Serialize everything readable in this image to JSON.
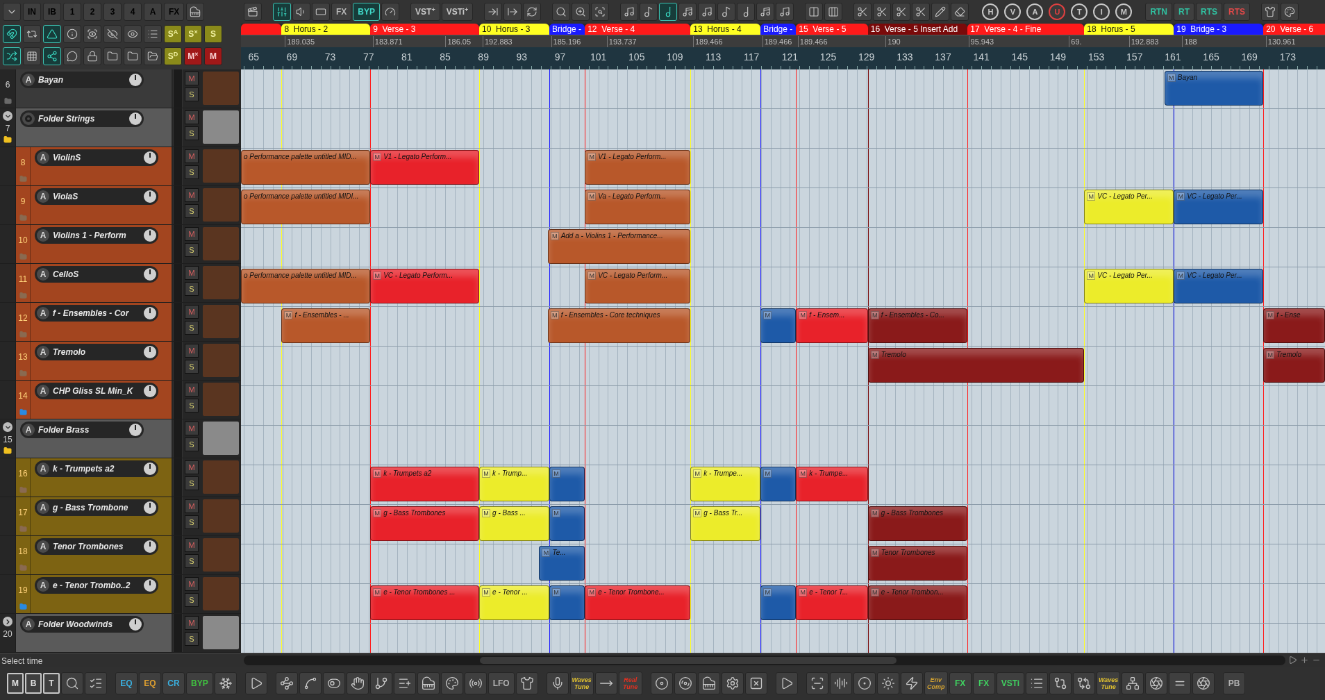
{
  "header_toolbar": [
    [
      {
        "kind": "icon",
        "on": false
      },
      {
        "kind": "text",
        "label": "IN",
        "on": false
      },
      {
        "kind": "text",
        "label": "IB",
        "on": false
      },
      {
        "kind": "text",
        "label": "1",
        "on": false
      },
      {
        "kind": "text",
        "label": "2",
        "on": false
      },
      {
        "kind": "text",
        "label": "3",
        "on": false
      },
      {
        "kind": "text",
        "label": "4",
        "on": false
      },
      {
        "kind": "text",
        "label": "A",
        "on": false
      },
      {
        "kind": "text",
        "label": "FX",
        "on": false
      },
      {
        "kind": "icon",
        "on": false
      }
    ],
    [
      {
        "kind": "icon",
        "on": true
      },
      {
        "kind": "icon",
        "on": false
      },
      {
        "kind": "icon",
        "on": true
      },
      {
        "kind": "icon",
        "on": false
      },
      {
        "kind": "icon",
        "on": false
      },
      {
        "kind": "icon",
        "on": false
      },
      {
        "kind": "icon",
        "on": false
      },
      {
        "kind": "icon",
        "on": false
      },
      {
        "kind": "solo",
        "label": "S$^{A}$",
        "on": false
      },
      {
        "kind": "solo",
        "label": "S$^{×}$",
        "on": false
      },
      {
        "kind": "solo",
        "label": "S",
        "on": false
      }
    ],
    [
      {
        "kind": "icon",
        "on": true
      },
      {
        "kind": "icon",
        "on": false
      },
      {
        "kind": "icon",
        "on": true
      },
      {
        "kind": "icon",
        "on": false
      },
      {
        "kind": "icon",
        "on": false
      },
      {
        "kind": "icon",
        "on": false
      },
      {
        "kind": "icon",
        "on": false
      },
      {
        "kind": "icon",
        "on": false
      },
      {
        "kind": "solo",
        "label": "S$^{D}$",
        "on": false
      },
      {
        "kind": "mute",
        "label": "M$^{×}$",
        "on": false
      },
      {
        "kind": "mute",
        "label": "M",
        "on": false
      }
    ]
  ],
  "main_toolbar": [
    [
      {
        "kind": "icon",
        "on": false
      }
    ],
    [
      {
        "kind": "icon",
        "on": true
      },
      {
        "kind": "icon",
        "on": false
      },
      {
        "kind": "icon",
        "on": false
      },
      {
        "kind": "text",
        "label": "FX",
        "color": "#b8b8b8",
        "on": false
      },
      {
        "kind": "text",
        "label": "BYP",
        "color": "#40d8c8",
        "on": true
      },
      {
        "kind": "icon",
        "on": false
      }
    ],
    [
      {
        "kind": "text",
        "label": "VST$^{+}$",
        "color": "#c8c8c8",
        "on": false
      },
      {
        "kind": "text",
        "label": "VSTi$^{+}$",
        "color": "#c8c8c8",
        "on": false
      }
    ],
    [
      {
        "kind": "icon",
        "on": false
      },
      {
        "kind": "icon",
        "on": false
      },
      {
        "kind": "icon",
        "on": false
      }
    ],
    [
      {
        "kind": "icon",
        "on": false
      },
      {
        "kind": "icon",
        "on": false
      },
      {
        "kind": "icon",
        "on": false
      }
    ],
    [
      {
        "kind": "icon",
        "on": false
      },
      {
        "kind": "icon",
        "on": false
      },
      {
        "kind": "icon",
        "on": true
      },
      {
        "kind": "icon",
        "on": false
      },
      {
        "kind": "icon",
        "on": false
      },
      {
        "kind": "icon",
        "on": false
      },
      {
        "kind": "icon",
        "on": false
      },
      {
        "kind": "icon",
        "on": false
      },
      {
        "kind": "icon",
        "on": false
      }
    ],
    [
      {
        "kind": "icon",
        "on": false
      },
      {
        "kind": "icon",
        "on": false
      }
    ],
    [
      {
        "kind": "icon",
        "on": false
      },
      {
        "kind": "icon",
        "on": false
      },
      {
        "kind": "icon",
        "on": false
      },
      {
        "kind": "icon",
        "on": false
      },
      {
        "kind": "icon",
        "on": false
      },
      {
        "kind": "icon",
        "on": false
      }
    ],
    [
      {
        "kind": "zoom",
        "label": "H",
        "color": "#c8c8c8",
        "on": false
      },
      {
        "kind": "zoom",
        "label": "V",
        "color": "#c8c8c8",
        "on": false
      },
      {
        "kind": "zoom",
        "label": "A",
        "color": "#c8c8c8",
        "on": false
      },
      {
        "kind": "zoom",
        "label": "U",
        "color": "#e04040",
        "on": false
      },
      {
        "kind": "zoom",
        "label": "T",
        "color": "#c8c8c8",
        "on": false
      },
      {
        "kind": "zoom",
        "label": "I",
        "color": "#c8c8c8",
        "on": false
      },
      {
        "kind": "zoom",
        "label": "M",
        "color": "#c8c8c8",
        "on": false
      }
    ],
    [
      {
        "kind": "text",
        "label": "RTN",
        "color": "#30c0a0",
        "on": false
      },
      {
        "kind": "text",
        "label": "RT",
        "color": "#30c0a0",
        "on": false
      },
      {
        "kind": "text",
        "label": "RTS",
        "color": "#30c0a0",
        "on": false
      },
      {
        "kind": "text",
        "label": "RTS",
        "color": "#e04848",
        "on": false
      }
    ],
    [
      {
        "kind": "icon",
        "on": false
      },
      {
        "kind": "icon",
        "on": false
      }
    ]
  ],
  "markers": [
    {
      "color": "#ff1a1a"
    },
    {
      "label": "8  Horus - 2",
      "color": "#ffff22"
    },
    {
      "label": "9  Verse - 3",
      "color": "#ff1a1a"
    },
    {
      "label": "10  Horus - 3",
      "color": "#ffff22"
    },
    {
      "label": "Bridge -",
      "color": "#1a1aff"
    },
    {
      "label": "12  Verse - 4",
      "color": "#ff1a1a"
    },
    {
      "label": "13  Horus - 4",
      "color": "#ffff22"
    },
    {
      "label": "Bridge -",
      "color": "#1a1aff"
    },
    {
      "label": "15  Verse - 5",
      "color": "#ff1a1a"
    },
    {
      "label": "16  Verse - 5 Insert Add",
      "color": "#7a0a0a"
    },
    {
      "label": "17  Verse - 4 - Fine",
      "color": "#ff1a1a"
    },
    {
      "label": "18  Horus - 5",
      "color": "#ffff22"
    },
    {
      "label": "19  Bridge - 3",
      "color": "#1a1aff"
    },
    {
      "label": "20  Verse - 6",
      "color": "#ff1a1a"
    }
  ],
  "tempo_row": [
    "189.035",
    "183.871",
    "186.05",
    "192.883",
    "185.196",
    "193.737",
    "189.466",
    "189.466",
    "189.466",
    "190",
    "95.943",
    "69.",
    "192.883",
    "188",
    "130.961"
  ],
  "ruler": [
    "65",
    "69",
    "73",
    "77",
    "81",
    "85",
    "89",
    "93",
    "97",
    "101",
    "105",
    "109",
    "113",
    "117",
    "121",
    "125",
    "129",
    "133",
    "137",
    "141",
    "145",
    "149",
    "153",
    "157",
    "161",
    "165",
    "169",
    "173"
  ],
  "tracks": [
    {
      "kind": "track",
      "number": "6",
      "name": "Bayan",
      "color": "#3a3a3a",
      "automation": "A",
      "mute": "M",
      "solo": "S",
      "clips": [
        {
          "label": "Bayan",
          "color": "#1e5aa8",
          "mute": "M"
        }
      ]
    },
    {
      "kind": "folder",
      "number": "7",
      "name": "Folder Strings",
      "color": "#5a5a5a",
      "expanded": true,
      "mute": "M",
      "solo": "S",
      "children": [
        {
          "kind": "track",
          "number": "8",
          "name": "ViolinS",
          "color": "#a3451f",
          "automation": "A",
          "mute": "M",
          "solo": "S",
          "clips": [
            {
              "label": "o Performance palette untitled MID...",
              "color": "#b8582a"
            },
            {
              "label": "V1 - Legato Perform...",
              "color": "#e8222a",
              "mute": "M"
            },
            {
              "label": "V1 - Legato Perform...",
              "color": "#b8582a",
              "mute": "M"
            }
          ]
        },
        {
          "kind": "track",
          "number": "9",
          "name": "ViolaS",
          "color": "#a3451f",
          "automation": "A",
          "mute": "M",
          "solo": "S",
          "clips": [
            {
              "label": "o Performance palette untitled MIDI...",
              "color": "#b8582a"
            },
            {
              "label": "Va - Legato Perform...",
              "color": "#b8582a",
              "mute": "M"
            },
            {
              "label": "VC - Legato Per...",
              "color": "#ecec2a",
              "mute": "M"
            },
            {
              "label": "VC - Legato Per...",
              "color": "#1e5aa8",
              "mute": "M"
            }
          ]
        },
        {
          "kind": "track",
          "number": "10",
          "name": "Violins 1 - Perform",
          "color": "#a3451f",
          "automation": "A",
          "mute": "M",
          "solo": "S",
          "clips": [
            {
              "label": "Add a - Violins 1 - Performance...",
              "color": "#b8582a",
              "mute": "M"
            }
          ]
        },
        {
          "kind": "track",
          "number": "11",
          "name": "CelloS",
          "color": "#a3451f",
          "automation": "A",
          "mute": "M",
          "solo": "S",
          "clips": [
            {
              "label": "o Performance palette untitled MID...",
              "color": "#b8582a"
            },
            {
              "label": "VC - Legato Perform...",
              "color": "#e8222a",
              "mute": "M"
            },
            {
              "label": "VC - Legato Perform...",
              "color": "#b8582a",
              "mute": "M"
            },
            {
              "label": "VC - Legato Per...",
              "color": "#ecec2a",
              "mute": "M"
            },
            {
              "label": "VC - Legato Per...",
              "color": "#1e5aa8",
              "mute": "M"
            }
          ]
        },
        {
          "kind": "track",
          "number": "12",
          "name": "f - Ensembles - Cor",
          "color": "#a3451f",
          "automation": "A",
          "mute": "M",
          "solo": "S",
          "clips": [
            {
              "label": "f - Ensembles - ...",
              "color": "#b8582a",
              "mute": "M"
            },
            {
              "label": "f - Ensembles - Core techniques",
              "color": "#b8582a",
              "mute": "M"
            },
            {
              "color": "#1e5aa8",
              "mute": "M"
            },
            {
              "label": "f - Ensem...",
              "color": "#e8222a",
              "mute": "M"
            },
            {
              "label": "f - Ensembles - Co...",
              "color": "#8a1a1a",
              "mute": "M"
            },
            {
              "label": "f - Ense",
              "color": "#8a1a1a",
              "mute": "M"
            }
          ]
        },
        {
          "kind": "track",
          "number": "13",
          "name": "Tremolo",
          "color": "#a3451f",
          "automation": "A",
          "mute": "M",
          "solo": "S",
          "clips": [
            {
              "label": "Tremolo",
              "color": "#8a1a1a",
              "mute": "M"
            },
            {
              "label": "Tremolo",
              "color": "#8a1a1a",
              "mute": "M"
            }
          ]
        },
        {
          "kind": "track",
          "number": "14",
          "name": "CHP Gliss SL Min_K",
          "color": "#a3451f",
          "automation": "A",
          "mute": "M",
          "solo": "S"
        }
      ]
    },
    {
      "kind": "folder",
      "number": "15",
      "name": "Folder Brass",
      "color": "#5a5a5a",
      "expanded": true,
      "automation": "A",
      "mute": "M",
      "solo": "S",
      "children": [
        {
          "kind": "track",
          "number": "16",
          "name": "k - Trumpets a2",
          "color": "#7d6312",
          "automation": "A",
          "mute": "M",
          "solo": "S",
          "clips": [
            {
              "label": "k - Trumpets a2",
              "color": "#e8222a",
              "mute": "M"
            },
            {
              "label": "k - Trump...",
              "color": "#ecec2a",
              "mute": "M"
            },
            {
              "color": "#1e5aa8",
              "mute": "M"
            },
            {
              "label": "k - Trumpe...",
              "color": "#ecec2a",
              "mute": "M"
            },
            {
              "color": "#1e5aa8",
              "mute": "M"
            },
            {
              "label": "k - Trumpe...",
              "color": "#e8222a",
              "mute": "M"
            }
          ]
        },
        {
          "kind": "track",
          "number": "17",
          "name": "g - Bass Trombone",
          "color": "#7d6312",
          "automation": "A",
          "mute": "M",
          "solo": "S",
          "clips": [
            {
              "label": "g - Bass Trombones",
              "color": "#e8222a",
              "mute": "M"
            },
            {
              "label": "g - Bass ...",
              "color": "#ecec2a",
              "mute": "M"
            },
            {
              "color": "#1e5aa8",
              "mute": "M"
            },
            {
              "label": "g - Bass Tr...",
              "color": "#ecec2a",
              "mute": "M"
            },
            {
              "label": "g - Bass Trombones",
              "color": "#8a1a1a",
              "mute": "M"
            }
          ]
        },
        {
          "kind": "track",
          "number": "18",
          "name": "Tenor Trombones",
          "color": "#7d6312",
          "automation": "A",
          "mute": "M",
          "solo": "S",
          "clips": [
            {
              "label": "Te...",
              "color": "#1e5aa8",
              "mute": "M"
            },
            {
              "label": "Tenor Trombones",
              "color": "#8a1a1a",
              "mute": "M"
            }
          ]
        },
        {
          "kind": "track",
          "number": "19",
          "name": "e - Tenor Trombo..2",
          "color": "#7d6312",
          "automation": "A",
          "mute": "M",
          "solo": "S",
          "clips": [
            {
              "label": "e - Tenor Trombones ...",
              "color": "#e8222a",
              "mute": "M"
            },
            {
              "label": "e - Tenor ...",
              "color": "#ecec2a",
              "mute": "M"
            },
            {
              "color": "#1e5aa8",
              "mute": "M"
            },
            {
              "label": "e - Tenor Trombone...",
              "color": "#e8222a",
              "mute": "M"
            },
            {
              "color": "#1e5aa8",
              "mute": "M"
            },
            {
              "label": "e - Tenor T...",
              "color": "#e8222a",
              "mute": "M"
            },
            {
              "label": "e - Tenor Trombon...",
              "color": "#8a1a1a",
              "mute": "M"
            }
          ]
        }
      ]
    },
    {
      "kind": "folder",
      "number": "20",
      "name": "Folder Woodwinds",
      "color": "#5a5a5a",
      "expanded": false,
      "automation": "A",
      "mute": "M",
      "solo": "S"
    }
  ],
  "status_bar": {
    "text": "Select time"
  },
  "bottom_toolbar": [
    [
      {
        "kind": "doc",
        "label": "M",
        "color": "#e0e0e0"
      },
      {
        "kind": "doc",
        "label": "B",
        "color": "#e0e0e0"
      },
      {
        "kind": "doc",
        "label": "T",
        "color": "#e0e0e0"
      },
      {
        "kind": "icon"
      },
      {
        "kind": "icon"
      }
    ],
    [
      {
        "kind": "text",
        "label": "EQ",
        "color": "#3ab0e0"
      },
      {
        "kind": "text",
        "label": "EQ",
        "color": "#e0a030"
      },
      {
        "kind": "text",
        "label": "CR",
        "color": "#3ab0e0"
      },
      {
        "kind": "text",
        "label": "BYP",
        "color": "#40c040"
      },
      {
        "kind": "icon"
      }
    ],
    [
      {
        "kind": "icon"
      }
    ],
    [
      {
        "kind": "icon"
      },
      {
        "kind": "icon"
      },
      {
        "kind": "icon"
      },
      {
        "kind": "icon"
      },
      {
        "kind": "icon"
      },
      {
        "kind": "icon"
      },
      {
        "kind": "icon"
      },
      {
        "kind": "icon"
      },
      {
        "kind": "icon"
      },
      {
        "kind": "text",
        "label": "LFO",
        "color": "#b0b0b0"
      },
      {
        "kind": "icon"
      }
    ],
    [
      {
        "kind": "icon"
      },
      {
        "kind": "stacked",
        "label": "Waves Tune",
        "color": "#e0c030"
      },
      {
        "kind": "icon"
      },
      {
        "kind": "stacked",
        "label": "Real Tune",
        "color": "#e03020"
      }
    ],
    [
      {
        "kind": "icon"
      },
      {
        "kind": "icon"
      },
      {
        "kind": "icon"
      },
      {
        "kind": "icon"
      },
      {
        "kind": "icon"
      }
    ],
    [
      {
        "kind": "icon"
      }
    ],
    [
      {
        "kind": "icon"
      },
      {
        "kind": "icon"
      },
      {
        "kind": "icon"
      },
      {
        "kind": "icon"
      },
      {
        "kind": "icon"
      },
      {
        "kind": "stacked",
        "label": "Env Comp",
        "color": "#d0a030"
      },
      {
        "kind": "text",
        "label": "FX",
        "color": "#40d060"
      },
      {
        "kind": "text",
        "label": "FX",
        "color": "#40d060"
      },
      {
        "kind": "text",
        "label": "VSTi",
        "color": "#40d060"
      },
      {
        "kind": "icon"
      },
      {
        "kind": "icon"
      },
      {
        "kind": "icon"
      },
      {
        "kind": "stacked",
        "label": "Waves Tune",
        "color": "#e0c030"
      },
      {
        "kind": "icon"
      },
      {
        "kind": "icon"
      },
      {
        "kind": "icon"
      },
      {
        "kind": "icon"
      }
    ],
    [
      {
        "kind": "text",
        "label": "PB",
        "color": "#b0b0b0"
      }
    ]
  ]
}
